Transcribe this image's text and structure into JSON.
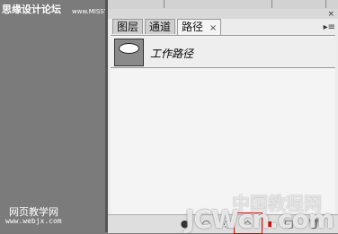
{
  "watermarks": {
    "top_left": "思缘设计论坛",
    "top_left_url": "www.MISSYUAN.COM",
    "bottom_left_title": "网页教学网",
    "bottom_left_url": "www.webjx.com",
    "bottom_right_title": "中国教程网",
    "bottom_right_logo": "JCWcn.com"
  },
  "panel": {
    "close_label": "×",
    "menu_label": "▸≡",
    "tabs": [
      {
        "label": "图层",
        "active": false
      },
      {
        "label": "通道",
        "active": false
      },
      {
        "label": "路径",
        "active": true,
        "close": "×"
      }
    ],
    "paths": [
      {
        "name": "工作路径"
      }
    ]
  },
  "icons": {
    "fill_path": "●",
    "stroke_path": "○",
    "load_selection": "◌",
    "make_work_path": "◇",
    "new_path": "□",
    "delete_path": "🗑"
  },
  "colors": {
    "highlight": "#e00000"
  }
}
